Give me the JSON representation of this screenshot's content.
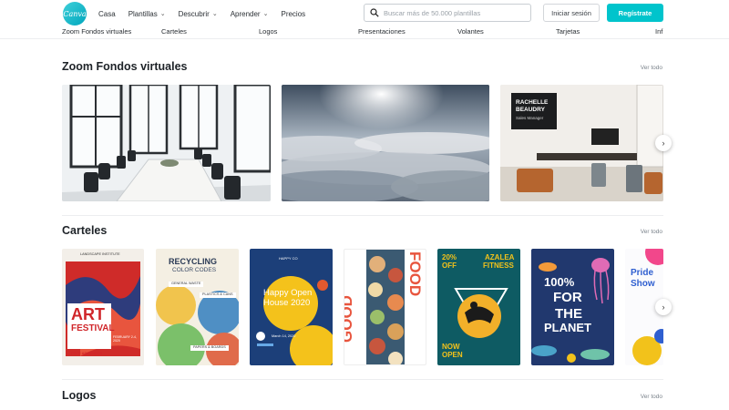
{
  "header": {
    "logo_text": "Canva",
    "nav": [
      {
        "label": "Casa",
        "dropdown": false
      },
      {
        "label": "Plantillas",
        "dropdown": true
      },
      {
        "label": "Descubrir",
        "dropdown": true
      },
      {
        "label": "Aprender",
        "dropdown": true
      },
      {
        "label": "Precios",
        "dropdown": false
      }
    ],
    "search_placeholder": "Buscar más de 50.000 plantillas",
    "login_label": "Iniciar sesión",
    "register_label": "Regístrate"
  },
  "categories": [
    "Zoom Fondos virtuales",
    "Carteles",
    "Logos",
    "Presentaciones",
    "Volantes",
    "Tarjetas",
    "Inf"
  ],
  "sections": [
    {
      "title": "Zoom Fondos virtuales",
      "see_all": "Ver todo"
    },
    {
      "title": "Carteles",
      "see_all": "Ver todo"
    },
    {
      "title": "Logos",
      "see_all": "Ver todo"
    }
  ],
  "zoom_cards": {
    "room_name_line1": "RACHELLE",
    "room_name_line2": "BEAUDRY",
    "room_role": "Sales Manager"
  },
  "posters": {
    "art": {
      "top": "LANDSCAPE INSTITUTE",
      "title1": "ART",
      "title2": "FESTIVAL",
      "date": "FEBRUARY 2-4, 2020",
      "tag": "FREE ADMISSION"
    },
    "recycling": {
      "title1": "RECYCLING",
      "title2": "COLOR CODES",
      "item1": "GENERAL WASTE",
      "item2": "PLASTICS & CANS",
      "item3": "PAPERS & BOARDS"
    },
    "openhouse": {
      "top": "HAPPY CO",
      "title1": "Happy Open",
      "title2": "House 2020",
      "date": "March 14, 2020"
    },
    "food": {
      "side1": "GOOD",
      "side2": "FOOD"
    },
    "fitness": {
      "pct": "20%",
      "off": "OFF",
      "brand1": "AZALEA",
      "brand2": "FITNESS",
      "cta1": "NOW",
      "cta2": "OPEN"
    },
    "planet": {
      "line1": "100%",
      "line2": "FOR",
      "line3": "THE",
      "line4": "PLANET"
    },
    "pride": {
      "line1": "Pride",
      "line2": "Show"
    }
  },
  "colors": {
    "accent": "#00c4cc",
    "text": "#1e2328"
  },
  "icons": {
    "search": "search-icon",
    "chevron": "chevron-down-icon",
    "next": "chevron-right-icon"
  }
}
